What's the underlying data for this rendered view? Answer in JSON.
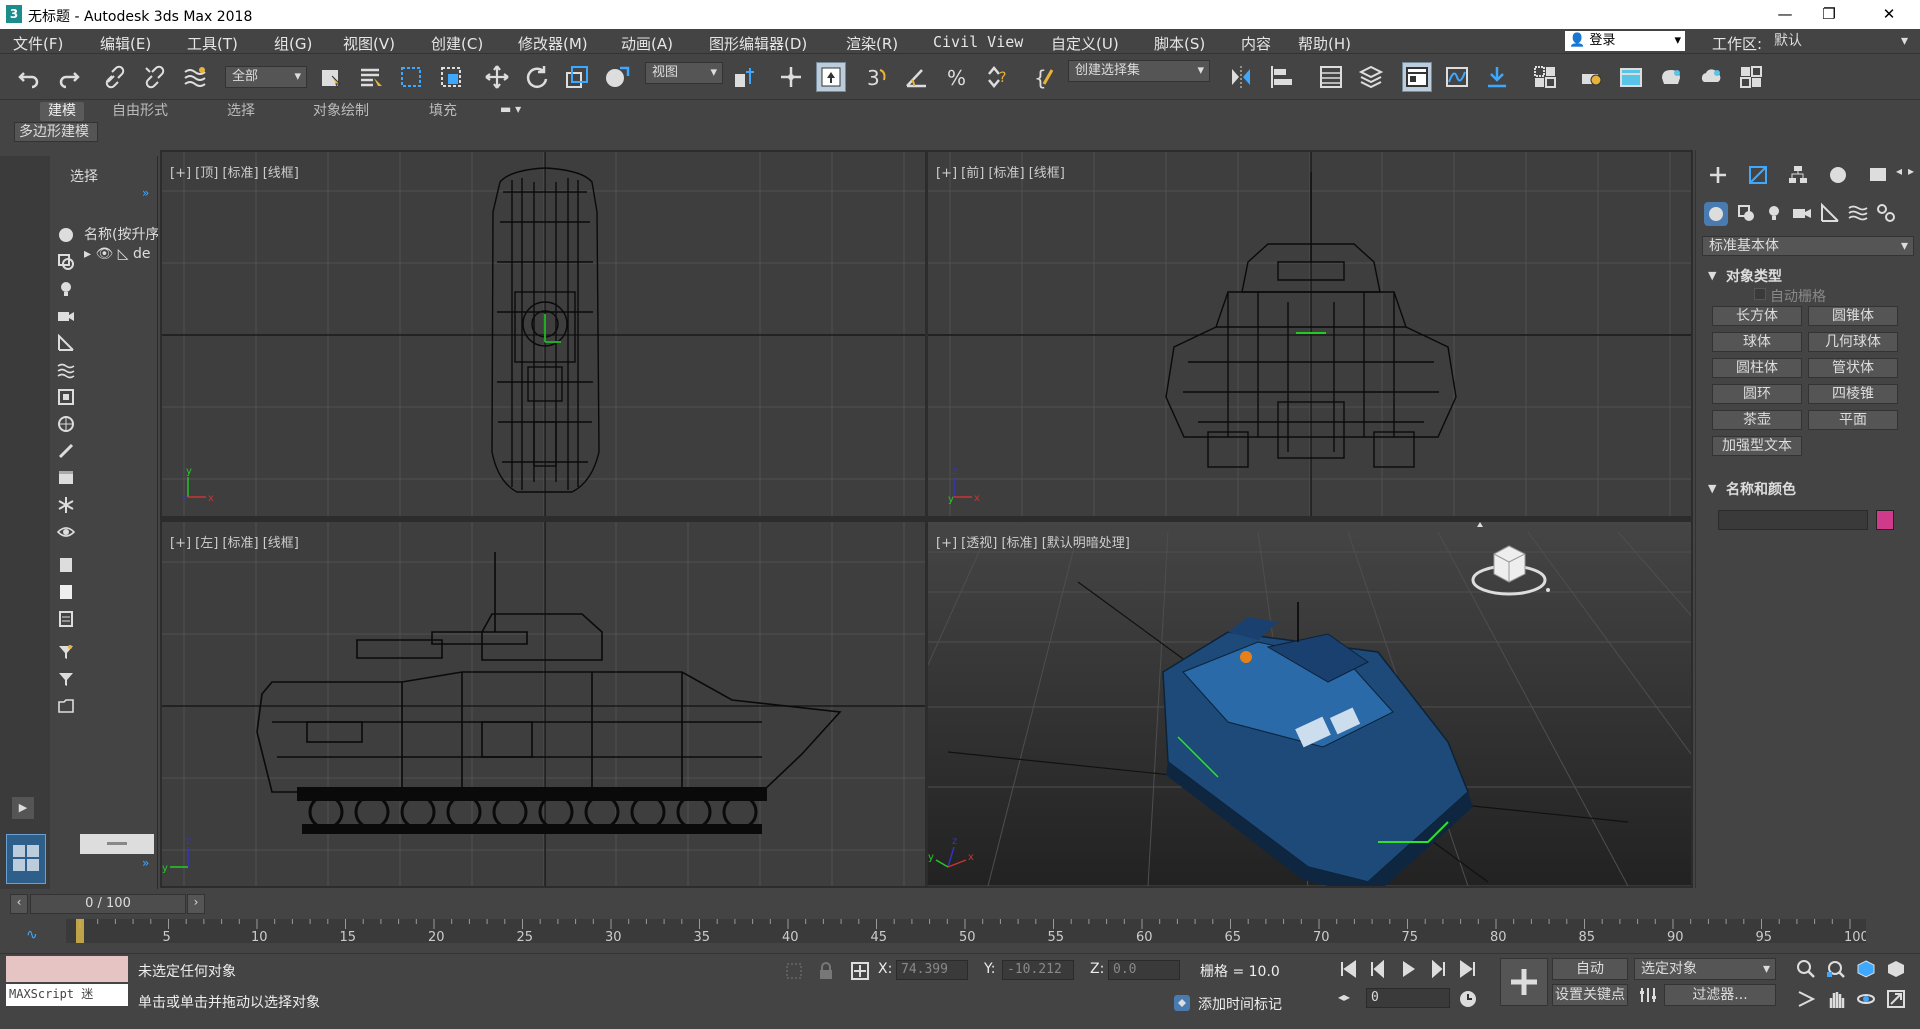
{
  "app": {
    "title": "无标题 - Autodesk 3ds Max 2018",
    "logo": "3"
  },
  "window_controls": {
    "minimize": "—",
    "maximize": "❐",
    "close": "✕"
  },
  "menu": [
    "文件(F)",
    "编辑(E)",
    "工具(T)",
    "组(G)",
    "视图(V)",
    "创建(C)",
    "修改器(M)",
    "动画(A)",
    "图形编辑器(D)",
    "渲染(R)",
    "Civil View",
    "自定义(U)",
    "脚本(S)",
    "内容",
    "帮助(H)"
  ],
  "login": {
    "label": "登录"
  },
  "workspace": {
    "label": "工作区:",
    "value": "默认"
  },
  "toolbar": {
    "filter": "全部",
    "refcoord": "视图",
    "selset": "创建选择集",
    "angle_snap": "3"
  },
  "ribbon": {
    "tabs": [
      "建模",
      "自由形式",
      "选择",
      "对象绘制",
      "填充"
    ],
    "active": 0,
    "sub": "多边形建模"
  },
  "explorer": {
    "title": "选择",
    "header": "名称(按升序",
    "row": "de"
  },
  "viewports": [
    {
      "label": "[+] [顶] [标准] [线框]"
    },
    {
      "label": "[+] [前] [标准] [线框]"
    },
    {
      "label": "[+] [左] [标准] [线框]"
    },
    {
      "label": "[+] [透视] [标准] [默认明暗处理]"
    }
  ],
  "command_panel": {
    "category": "标准基本体",
    "object_type": "对象类型",
    "autogrid": "自动栅格",
    "buttons": [
      "长方体",
      "圆锥体",
      "球体",
      "几何球体",
      "圆柱体",
      "管状体",
      "圆环",
      "四棱锥",
      "茶壶",
      "平面",
      "加强型文本"
    ],
    "name_color": "名称和颜色",
    "color": "#d03a8a"
  },
  "timeline": {
    "frame": "0 / 100",
    "ticks": [
      "0",
      "5",
      "10",
      "15",
      "20",
      "25",
      "30",
      "35",
      "40",
      "45",
      "50",
      "55",
      "60",
      "65",
      "70",
      "75",
      "80",
      "85",
      "90",
      "95",
      "100"
    ]
  },
  "status": {
    "maxscript": "MAXScript 迷",
    "line1": "未选定任何对象",
    "line2": "单击或单击并拖动以选择对象",
    "x_label": "X:",
    "x": "74.399",
    "y_label": "Y:",
    "y": "-10.212",
    "z_label": "Z:",
    "z": "0.0",
    "grid": "栅格 = 10.0",
    "add_time_tag": "添加时间标记",
    "auto": "自动",
    "selected": "选定对象",
    "set_key": "设置关键点",
    "filters": "过滤器...",
    "frame_value": "0"
  }
}
